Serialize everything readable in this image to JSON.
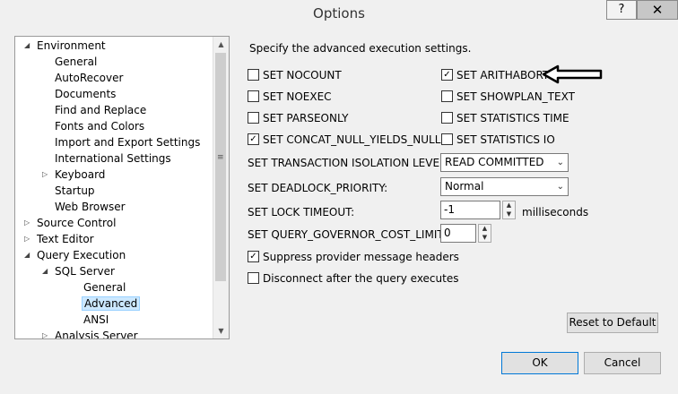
{
  "window": {
    "title": "Options",
    "help_label": "?",
    "close_label": "✕"
  },
  "tree": {
    "items": [
      {
        "label": "Environment",
        "level": 0,
        "expander": "expanded"
      },
      {
        "label": "General",
        "level": 1,
        "expander": "none"
      },
      {
        "label": "AutoRecover",
        "level": 1,
        "expander": "none"
      },
      {
        "label": "Documents",
        "level": 1,
        "expander": "none"
      },
      {
        "label": "Find and Replace",
        "level": 1,
        "expander": "none"
      },
      {
        "label": "Fonts and Colors",
        "level": 1,
        "expander": "none"
      },
      {
        "label": "Import and Export Settings",
        "level": 1,
        "expander": "none"
      },
      {
        "label": "International Settings",
        "level": 1,
        "expander": "none"
      },
      {
        "label": "Keyboard",
        "level": 1,
        "expander": "collapsed"
      },
      {
        "label": "Startup",
        "level": 1,
        "expander": "none"
      },
      {
        "label": "Web Browser",
        "level": 1,
        "expander": "none"
      },
      {
        "label": "Source Control",
        "level": 0,
        "expander": "collapsed"
      },
      {
        "label": "Text Editor",
        "level": 0,
        "expander": "collapsed"
      },
      {
        "label": "Query Execution",
        "level": 0,
        "expander": "expanded"
      },
      {
        "label": "SQL Server",
        "level": 1,
        "expander": "expanded"
      },
      {
        "label": "General",
        "level": 2,
        "expander": "none"
      },
      {
        "label": "Advanced",
        "level": 2,
        "expander": "none",
        "selected": true
      },
      {
        "label": "ANSI",
        "level": 2,
        "expander": "none"
      },
      {
        "label": "Analysis Server",
        "level": 1,
        "expander": "collapsed"
      }
    ]
  },
  "panel": {
    "heading": "Specify the advanced execution settings.",
    "checkboxes": {
      "nocount": {
        "label": "SET NOCOUNT",
        "checked": false
      },
      "noexec": {
        "label": "SET NOEXEC",
        "checked": false
      },
      "parseonly": {
        "label": "SET PARSEONLY",
        "checked": false
      },
      "concat_null": {
        "label": "SET CONCAT_NULL_YIELDS_NULL",
        "checked": true
      },
      "arithabort": {
        "label": "SET ARITHABORT",
        "checked": true
      },
      "showplan_text": {
        "label": "SET SHOWPLAN_TEXT",
        "checked": false
      },
      "statistics_time": {
        "label": "SET STATISTICS TIME",
        "checked": false
      },
      "statistics_io": {
        "label": "SET STATISTICS IO",
        "checked": false
      },
      "suppress_headers": {
        "label": "Suppress provider message headers",
        "checked": true
      },
      "disconnect": {
        "label": "Disconnect after the query executes",
        "checked": false
      }
    },
    "isolation_label": "SET TRANSACTION ISOLATION LEVEL:",
    "isolation_value": "READ COMMITTED",
    "deadlock_label": "SET DEADLOCK_PRIORITY:",
    "deadlock_value": "Normal",
    "lock_timeout_label": "SET LOCK TIMEOUT:",
    "lock_timeout_value": "-1",
    "lock_timeout_unit": "milliseconds",
    "governor_label": "SET QUERY_GOVERNOR_COST_LIMIT:",
    "governor_value": "0",
    "reset_label": "Reset to Default"
  },
  "footer": {
    "ok_label": "OK",
    "cancel_label": "Cancel"
  },
  "icons": {
    "check": "✓",
    "expanded": "◢",
    "collapsed": "▷",
    "up": "▲",
    "down": "▼",
    "caret": "⌄"
  }
}
